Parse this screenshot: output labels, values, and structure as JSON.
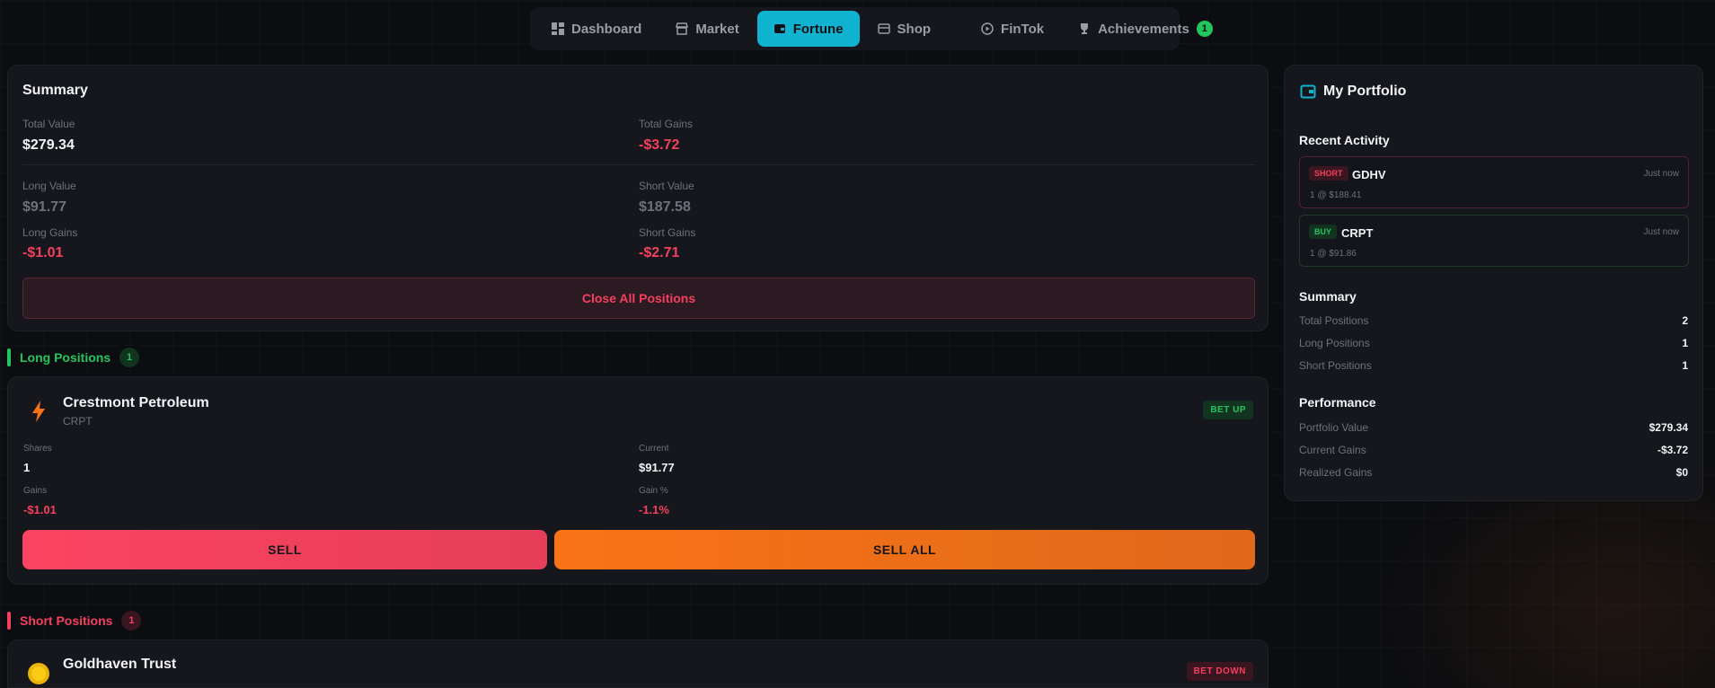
{
  "nav": {
    "items": [
      {
        "label": "Dashboard"
      },
      {
        "label": "Market"
      },
      {
        "label": "Fortune"
      },
      {
        "label": "Shop"
      },
      {
        "label": "FinTok"
      },
      {
        "label": "Achievements",
        "badge": "1"
      }
    ]
  },
  "summary": {
    "title": "Summary",
    "total_value_label": "Total Value",
    "total_value": "$279.34",
    "total_gains_label": "Total Gains",
    "total_gains": "-$3.72",
    "long_value_label": "Long Value",
    "long_value": "$91.77",
    "short_value_label": "Short Value",
    "short_value": "$187.58",
    "long_gains_label": "Long Gains",
    "long_gains": "-$1.01",
    "short_gains_label": "Short Gains",
    "short_gains": "-$2.71",
    "close_all_label": "Close All Positions"
  },
  "long_section": {
    "title": "Long Positions",
    "count": "1"
  },
  "long_position": {
    "name": "Crestmont Petroleum",
    "ticker": "CRPT",
    "badge": "BET UP",
    "shares_label": "Shares",
    "shares": "1",
    "current_label": "Current",
    "current": "$91.77",
    "gains_label": "Gains",
    "gains": "-$1.01",
    "gain_pct_label": "Gain %",
    "gain_pct": "-1.1%",
    "sell_label": "SELL",
    "sell_all_label": "SELL ALL"
  },
  "short_section": {
    "title": "Short Positions",
    "count": "1"
  },
  "short_position": {
    "name": "Goldhaven Trust",
    "badge": "BET DOWN"
  },
  "portfolio": {
    "title": "My Portfolio",
    "recent_title": "Recent Activity",
    "activity": [
      {
        "tag": "SHORT",
        "ticker": "GDHV",
        "time": "Just now",
        "detail": "1 @ $188.41"
      },
      {
        "tag": "BUY",
        "ticker": "CRPT",
        "time": "Just now",
        "detail": "1 @ $91.86"
      }
    ],
    "summary_title": "Summary",
    "summary_rows": [
      {
        "label": "Total Positions",
        "value": "2"
      },
      {
        "label": "Long Positions",
        "value": "1"
      },
      {
        "label": "Short Positions",
        "value": "1"
      }
    ],
    "performance_title": "Performance",
    "performance_rows": [
      {
        "label": "Portfolio Value",
        "value": "$279.34"
      },
      {
        "label": "Current Gains",
        "value": "-$3.72"
      },
      {
        "label": "Realized Gains",
        "value": "$0"
      }
    ]
  }
}
